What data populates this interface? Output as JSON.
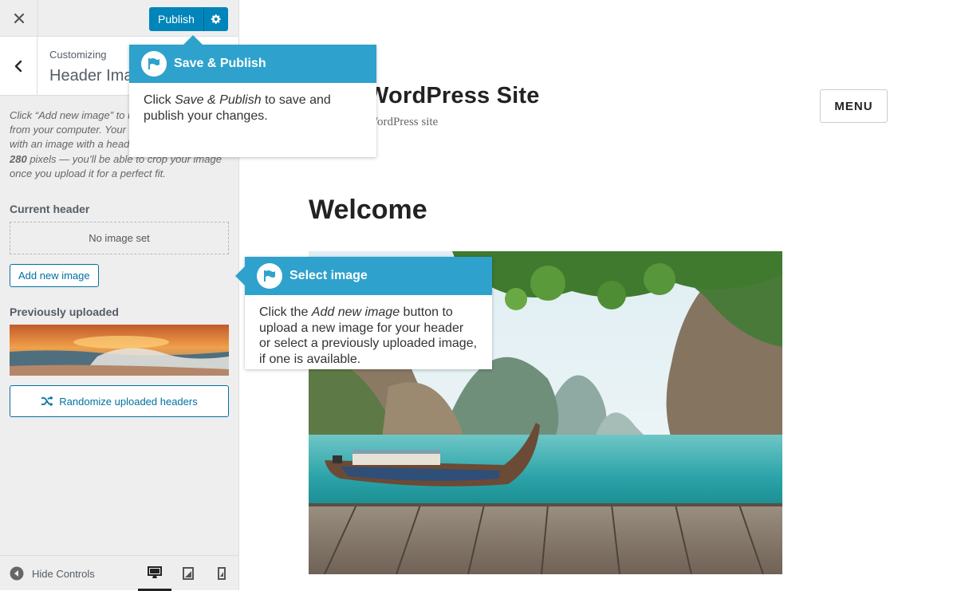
{
  "topbar": {
    "close_icon": "close-icon",
    "publish_label": "Publish",
    "gear_icon": "gear-icon",
    "accent_color": "#0085ba"
  },
  "section": {
    "customizing_label": "Customizing",
    "title": "Header Image"
  },
  "panel": {
    "description_line1": "Click “Add new image” to upload a image file from your computer. Your theme works best with an image with a header size of ",
    "description_size": "1200 × 280",
    "description_line2": " pixels — you’ll be able to crop your image once you upload it for a perfect fit.",
    "current_header_label": "Current header",
    "no_image_text": "No image set",
    "add_new_label": "Add new image",
    "previously_uploaded_label": "Previously uploaded",
    "randomize_label": "Randomize uploaded headers"
  },
  "footer": {
    "hide_controls_label": "Hide Controls",
    "devices": [
      "desktop",
      "tablet",
      "mobile"
    ],
    "active_device": "desktop"
  },
  "preview": {
    "site_title": "WordPress Site",
    "site_tagline": "WordPress site",
    "menu_label": "MENU",
    "heading": "Welcome"
  },
  "tooltips": {
    "publish": {
      "title": "Save & Publish",
      "body_pre": "Click ",
      "body_em": "Save & Publish",
      "body_post": " to save and publish your changes."
    },
    "select": {
      "title": "Select image",
      "body_pre": "Click the ",
      "body_em": "Add new image",
      "body_post": " button to upload a new image for your header or select a previously uploaded image, if one is available."
    },
    "header_color": "#2ea2cc"
  }
}
